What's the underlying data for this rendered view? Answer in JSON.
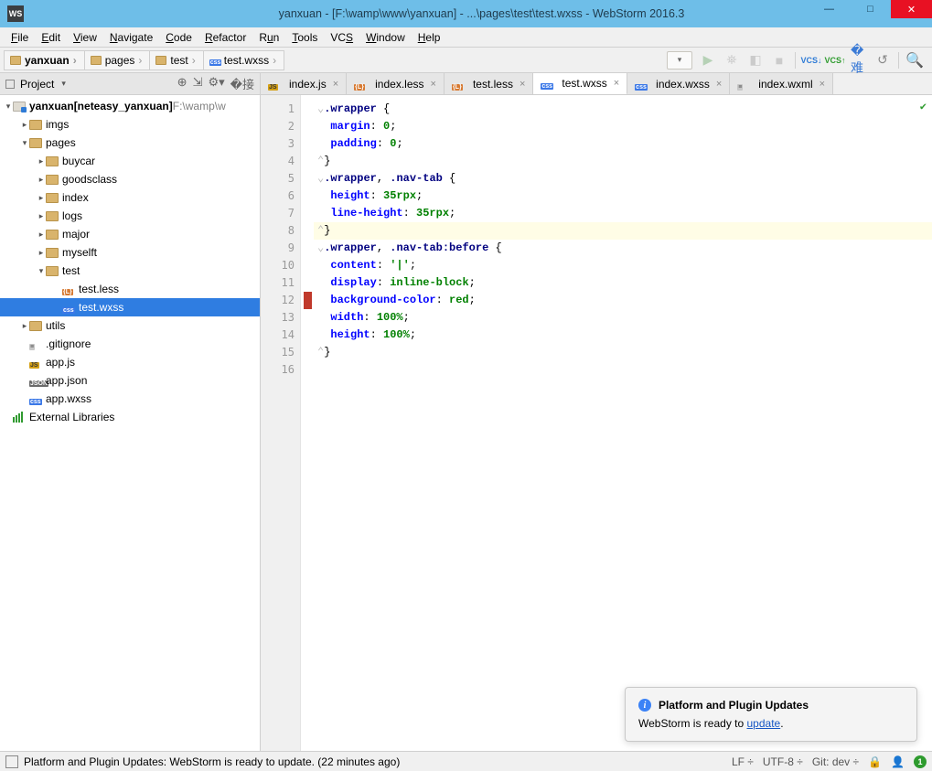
{
  "window_title": "yanxuan - [F:\\wamp\\www\\yanxuan] - ...\\pages\\test\\test.wxss - WebStorm 2016.3",
  "menus": [
    "File",
    "Edit",
    "View",
    "Navigate",
    "Code",
    "Refactor",
    "Run",
    "Tools",
    "VCS",
    "Window",
    "Help"
  ],
  "breadcrumbs": [
    {
      "label": "yanxuan",
      "bold": true,
      "icon": "dir"
    },
    {
      "label": "pages",
      "icon": "dir"
    },
    {
      "label": "test",
      "icon": "dir"
    },
    {
      "label": "test.wxss",
      "icon": "css"
    }
  ],
  "project_panel_title": "Project",
  "project_root": {
    "name": "yanxuan",
    "qualifier": "[neteasy_yanxuan]",
    "path": "F:\\wamp\\w"
  },
  "tree": {
    "imgs": "imgs",
    "pages": "pages",
    "pages_children": [
      "buycar",
      "goodsclass",
      "index",
      "logs",
      "major",
      "myselft",
      "test"
    ],
    "test_children": [
      {
        "name": "test.less",
        "t": "less"
      },
      {
        "name": "test.wxss",
        "t": "css",
        "selected": true
      }
    ],
    "utils": "utils",
    "root_files": [
      {
        "name": ".gitignore",
        "t": "txt"
      },
      {
        "name": "app.js",
        "t": "js"
      },
      {
        "name": "app.json",
        "t": "json"
      },
      {
        "name": "app.wxss",
        "t": "css"
      }
    ],
    "ext_lib": "External Libraries"
  },
  "tabs": [
    {
      "name": "index.js",
      "t": "js"
    },
    {
      "name": "index.less",
      "t": "less"
    },
    {
      "name": "test.less",
      "t": "less"
    },
    {
      "name": "test.wxss",
      "t": "css",
      "active": true
    },
    {
      "name": "index.wxss",
      "t": "css"
    },
    {
      "name": "index.wxml",
      "t": "txt"
    }
  ],
  "code_lines": [
    {
      "n": 1,
      "seg": [
        [
          "fold",
          "⌄"
        ],
        [
          "sel-cls",
          ".wrapper"
        ],
        [
          "punct",
          " {"
        ]
      ]
    },
    {
      "n": 2,
      "seg": [
        [
          "",
          "  "
        ],
        [
          "prop",
          "margin"
        ],
        [
          "punct",
          ": "
        ],
        [
          "num",
          "0"
        ],
        [
          "punct",
          ";"
        ]
      ]
    },
    {
      "n": 3,
      "seg": [
        [
          "",
          "  "
        ],
        [
          "prop",
          "padding"
        ],
        [
          "punct",
          ": "
        ],
        [
          "num",
          "0"
        ],
        [
          "punct",
          ";"
        ]
      ]
    },
    {
      "n": 4,
      "seg": [
        [
          "fold",
          "⌃"
        ],
        [
          "punct",
          "}"
        ]
      ]
    },
    {
      "n": 5,
      "seg": [
        [
          "fold",
          "⌄"
        ],
        [
          "sel-cls",
          ".wrapper"
        ],
        [
          "",
          ", "
        ],
        [
          "sel-cls",
          ".nav-tab"
        ],
        [
          "punct",
          " {"
        ]
      ]
    },
    {
      "n": 6,
      "seg": [
        [
          "",
          "  "
        ],
        [
          "prop",
          "height"
        ],
        [
          "punct",
          ": "
        ],
        [
          "num",
          "35rpx"
        ],
        [
          "punct",
          ";"
        ]
      ]
    },
    {
      "n": 7,
      "seg": [
        [
          "",
          "  "
        ],
        [
          "prop",
          "line-height"
        ],
        [
          "punct",
          ": "
        ],
        [
          "num",
          "35rpx"
        ],
        [
          "punct",
          ";"
        ]
      ]
    },
    {
      "n": 8,
      "hl": true,
      "seg": [
        [
          "fold",
          "⌃"
        ],
        [
          "punct",
          "}"
        ]
      ]
    },
    {
      "n": 9,
      "seg": [
        [
          "fold",
          "⌄"
        ],
        [
          "sel-cls",
          ".wrapper"
        ],
        [
          "",
          ", "
        ],
        [
          "sel-cls",
          ".nav-tab"
        ],
        [
          "pseudo",
          ":before"
        ],
        [
          "punct",
          " {"
        ]
      ]
    },
    {
      "n": 10,
      "seg": [
        [
          "",
          "  "
        ],
        [
          "prop",
          "content"
        ],
        [
          "punct",
          ": "
        ],
        [
          "val",
          "'|'"
        ],
        [
          "punct",
          ";"
        ]
      ]
    },
    {
      "n": 11,
      "seg": [
        [
          "",
          "  "
        ],
        [
          "prop",
          "display"
        ],
        [
          "punct",
          ": "
        ],
        [
          "val",
          "inline-block"
        ],
        [
          "punct",
          ";"
        ]
      ]
    },
    {
      "n": 12,
      "marker": "red",
      "seg": [
        [
          "",
          "  "
        ],
        [
          "prop",
          "background-color"
        ],
        [
          "punct",
          ": "
        ],
        [
          "val",
          "red"
        ],
        [
          "punct",
          ";"
        ]
      ]
    },
    {
      "n": 13,
      "seg": [
        [
          "",
          "  "
        ],
        [
          "prop",
          "width"
        ],
        [
          "punct",
          ": "
        ],
        [
          "num",
          "100%"
        ],
        [
          "punct",
          ";"
        ]
      ]
    },
    {
      "n": 14,
      "seg": [
        [
          "",
          "  "
        ],
        [
          "prop",
          "height"
        ],
        [
          "punct",
          ": "
        ],
        [
          "num",
          "100%"
        ],
        [
          "punct",
          ";"
        ]
      ]
    },
    {
      "n": 15,
      "seg": [
        [
          "fold",
          "⌃"
        ],
        [
          "punct",
          "}"
        ]
      ]
    },
    {
      "n": 16,
      "seg": [
        [
          "",
          ""
        ]
      ]
    }
  ],
  "notification": {
    "title": "Platform and Plugin Updates",
    "body_prefix": "WebStorm is ready to ",
    "link": "update",
    "body_suffix": "."
  },
  "status": {
    "msg": "Platform and Plugin Updates: WebStorm is ready to update. (22 minutes ago)",
    "line_sep": "LF",
    "encoding": "UTF-8",
    "git": "Git: dev",
    "badge": "1"
  }
}
